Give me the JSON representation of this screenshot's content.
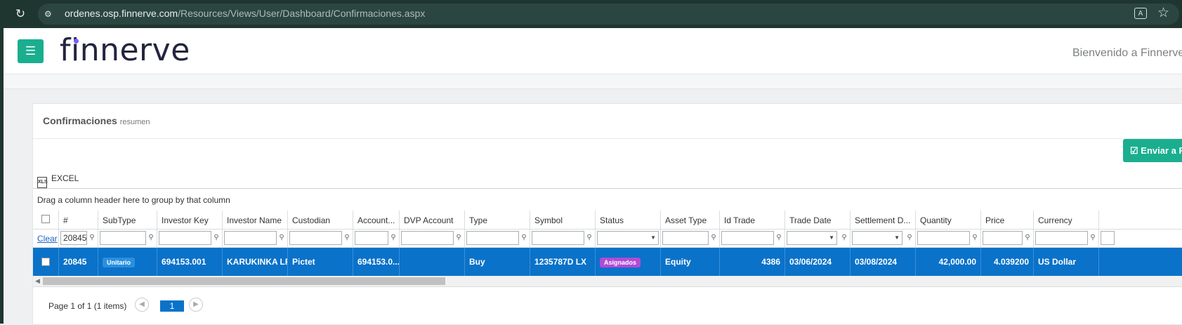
{
  "browser": {
    "url_host": "ordenes.osp.finnerve.com",
    "url_path": "/Resources/Views/User/Dashboard/Confirmaciones.aspx"
  },
  "app": {
    "logo": "finnerve",
    "welcome": "Bienvenido a Finnerve",
    "accent_color": "#1aae8f"
  },
  "panel": {
    "title": "Confirmaciones",
    "subtitle": "resumen",
    "send_button": "Enviar a F",
    "excel_label": "EXCEL"
  },
  "grid": {
    "group_hint": "Drag a column header here to group by that column",
    "clear_label": "Clear",
    "columns": [
      "#",
      "SubType",
      "Investor Key",
      "Investor Name",
      "Custodian",
      "Account...",
      "DVP Account",
      "Type",
      "Symbol",
      "Status",
      "Asset Type",
      "Id Trade",
      "Trade Date",
      "Settlement D...",
      "Quantity",
      "Price",
      "Currency"
    ],
    "filter_number": "20845",
    "row": {
      "number": "20845",
      "subtype": "Unitario",
      "investor_key": "694153.001",
      "investor_name": "KARUKINKA LP",
      "custodian": "Pictet",
      "account": "694153.0...",
      "dvp_account": "",
      "type": "Buy",
      "symbol": "1235787D LX",
      "status": "Asignados",
      "asset_type": "Equity",
      "id_trade": "4386",
      "trade_date": "03/06/2024",
      "settlement_date": "03/08/2024",
      "quantity": "42,000.00",
      "price": "4.039200",
      "currency": "US Dollar"
    },
    "badge_colors": {
      "subtype": "#2a8fe0",
      "status": "#b14bd6"
    }
  },
  "pager": {
    "info": "Page 1 of 1 (1 items)",
    "current_page": "1"
  }
}
